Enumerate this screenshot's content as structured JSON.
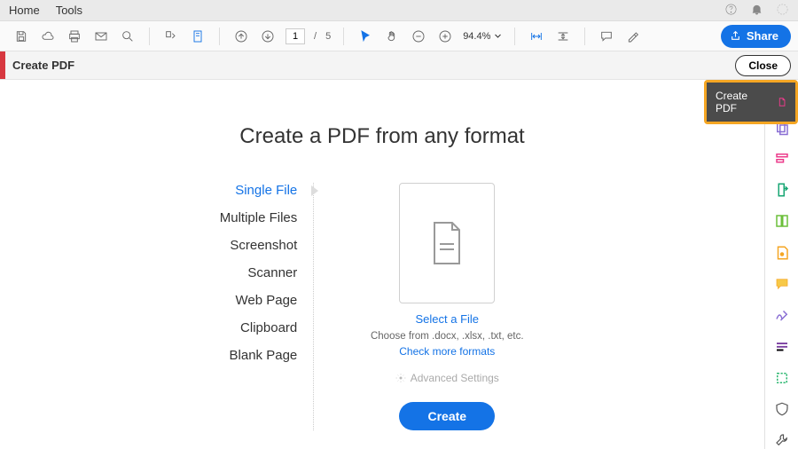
{
  "menubar": {
    "home": "Home",
    "tools": "Tools"
  },
  "toolbar": {
    "page_current": "1",
    "page_sep": "/",
    "page_total": "5",
    "zoom": "94.4%"
  },
  "share_label": "Share",
  "subbar": {
    "title": "Create PDF",
    "close": "Close"
  },
  "callout": {
    "label": "Create PDF"
  },
  "heading": "Create a PDF from any format",
  "sources": [
    "Single File",
    "Multiple Files",
    "Screenshot",
    "Scanner",
    "Web Page",
    "Clipboard",
    "Blank Page"
  ],
  "form": {
    "select": "Select a File",
    "hint": "Choose from .docx, .xlsx, .txt, etc.",
    "more": "Check more formats",
    "adv": "Advanced Settings",
    "create": "Create"
  }
}
